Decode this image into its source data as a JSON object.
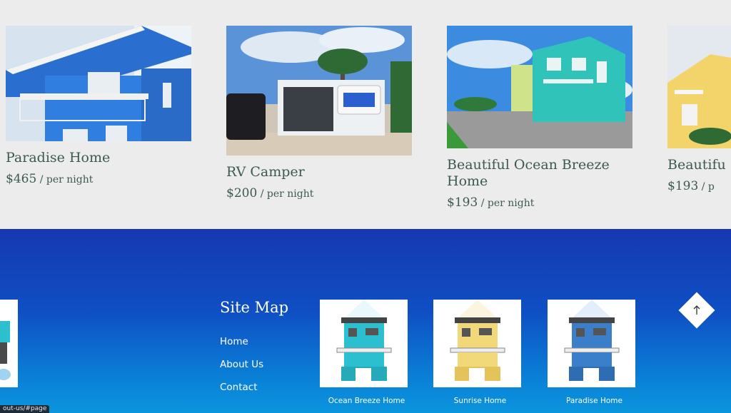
{
  "listings": [
    {
      "title": "Paradise Home",
      "price": "$465",
      "per": " / per night"
    },
    {
      "title": "RV Camper",
      "price": "$200",
      "per": " / per night"
    },
    {
      "title": "Beautiful Ocean Breeze Home",
      "price": "$193",
      "per": " / per night"
    },
    {
      "title": "Beautifu",
      "price": "$193",
      "per": " / p"
    }
  ],
  "footer": {
    "sitemap_title": "Site Map",
    "links": [
      "Home",
      "About Us",
      "Contact"
    ],
    "thumbs": [
      {
        "caption": "Ocean Breeze Home",
        "color": "#2bbfcf"
      },
      {
        "caption": "Sunrise Home",
        "color": "#f1d878"
      },
      {
        "caption": "Paradise Home",
        "color": "#3b7fcb"
      }
    ]
  },
  "status_url": "out-us/#page",
  "colors": {
    "title_text": "#3b5a52",
    "footer_top": "#1638b0",
    "footer_bottom": "#0b95dd"
  }
}
